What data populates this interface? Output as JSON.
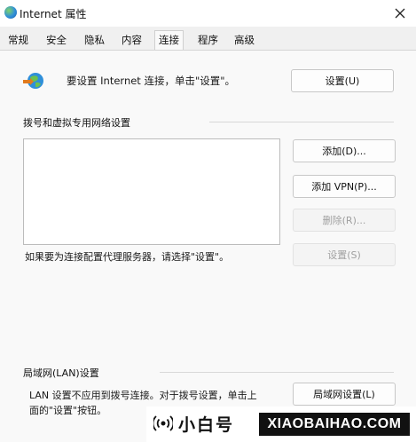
{
  "window": {
    "title": "Internet 属性",
    "close_glyph": "✕"
  },
  "tabs": [
    {
      "label": "常规",
      "active": false
    },
    {
      "label": "安全",
      "active": false
    },
    {
      "label": "隐私",
      "active": false
    },
    {
      "label": "内容",
      "active": false
    },
    {
      "label": "连接",
      "active": true
    },
    {
      "label": "程序",
      "active": false
    },
    {
      "label": "高级",
      "active": false
    }
  ],
  "setup": {
    "text": "要设置 Internet 连接，单击\"设置\"。",
    "button": "设置(U)"
  },
  "dialup": {
    "group_label": "拨号和虚拟专用网络设置",
    "add_button": "添加(D)...",
    "add_vpn_button": "添加 VPN(P)...",
    "remove_button": "删除(R)...",
    "settings_button": "设置(S)",
    "proxy_text": "如果要为连接配置代理服务器，请选择\"设置\"。"
  },
  "lan": {
    "group_label": "局域网(LAN)设置",
    "text_line1": "LAN 设置不应用到拨号连接。对于拨号设置，单击上",
    "text_line2": "面的\"设置\"按钮。",
    "button": "局域网设置(L)"
  },
  "footer": {
    "brand": "小白号",
    "domain": "XIAOBAIHAO.COM"
  },
  "colors": {
    "accent": "#2f8fd9",
    "brand_bg": "#111111"
  }
}
